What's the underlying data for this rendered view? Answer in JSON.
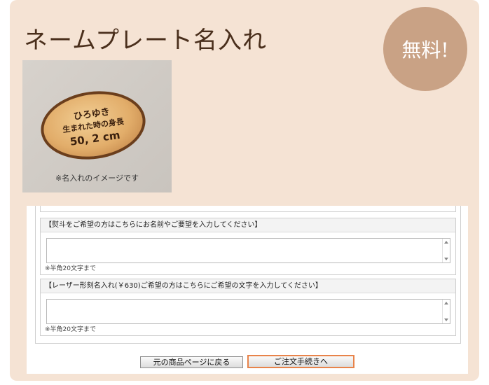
{
  "title": "ネームプレート名入れ",
  "badge": "無料!",
  "photo": {
    "plate_line1": "ひろゆき",
    "plate_line2": "生まれた時の身長",
    "plate_line3": "50, 2 cm",
    "caption": "※名入れのイメージです"
  },
  "form": {
    "section1": {
      "header": "【熨斗をご希望の方はこちらにお名前やご要望を入力してください】",
      "note": "※半角20文字まで"
    },
    "section2": {
      "header": "【レーザー形刻名入れ(￥630)ご希望の方はこちらにご希望の文字を入力してください】",
      "note": "※半角20文字まで"
    }
  },
  "buttons": {
    "back": "元の商品ページに戻る",
    "order": "ご注文手続きへ"
  },
  "colors": {
    "background": "#f5e3d4",
    "title": "#4a2f1c",
    "badge": "#c9a285",
    "accent_border": "#e8834a"
  }
}
